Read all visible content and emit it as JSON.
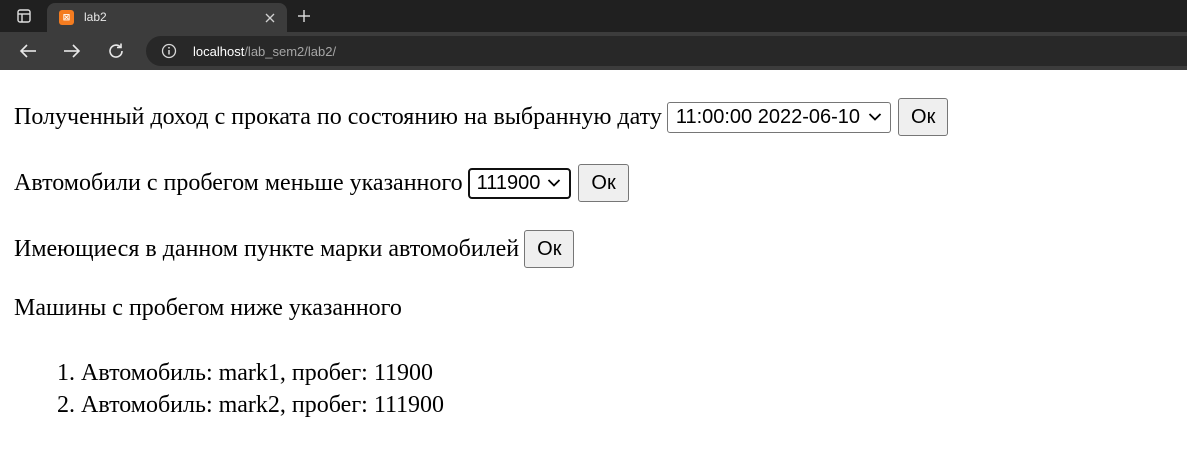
{
  "browser": {
    "tab": {
      "title": "lab2",
      "favicon_text": "⊠"
    },
    "address": {
      "host": "localhost",
      "path": "/lab_sem2/lab2/"
    }
  },
  "icons": {
    "tabs_menu": "tab-actions-icon",
    "favicon": "xampp-icon",
    "close": "close-icon",
    "new_tab": "plus-icon",
    "back": "back-arrow-icon",
    "forward": "forward-arrow-icon",
    "reload": "reload-icon",
    "info": "info-icon",
    "chevron": "chevron-down-icon"
  },
  "form_income": {
    "label": "Полученный доход с проката по состоянию на выбранную дату",
    "selected": "11:00:00 2022-06-10",
    "button": "Ок"
  },
  "form_mileage": {
    "label": "Автомобили с пробегом меньше указанного",
    "selected": "111900",
    "button": "Ок"
  },
  "form_brands": {
    "label": "Имеющиеся в данном пункте марки автомобилей",
    "button": "Ок"
  },
  "results": {
    "heading": "Машины с пробегом ниже указанного",
    "items": [
      {
        "num": "1.",
        "text": "Автомобиль: mark1, пробег: 11900"
      },
      {
        "num": "2.",
        "text": "Автомобиль: mark2, пробег: 111900"
      }
    ]
  },
  "colors": {
    "tabbar_bg": "#202020",
    "toolbar_bg": "#3c3c3c",
    "omnibox_bg": "#282828",
    "favicon": "#f47c20"
  }
}
